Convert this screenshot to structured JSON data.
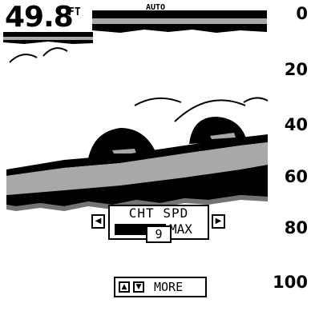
{
  "depth": {
    "value": "49.8",
    "unit": "FT"
  },
  "gain_mode": "AUTO",
  "depth_scale": [
    "0",
    "20",
    "40",
    "60",
    "80",
    "100"
  ],
  "chart_speed_menu": {
    "title": "CHT SPD",
    "max_label": "MAX",
    "value": "9",
    "level_fraction": 1.0,
    "left_arrow_icon": "left-arrow-icon",
    "right_arrow_icon": "right-arrow-icon"
  },
  "more_button": {
    "label": "MORE",
    "up_icon": "up-arrow-icon",
    "down_icon": "down-arrow-icon"
  },
  "colors": {
    "background": "#ffffff",
    "foreground": "#000000",
    "bottom_gray": "#a8a8a8"
  }
}
